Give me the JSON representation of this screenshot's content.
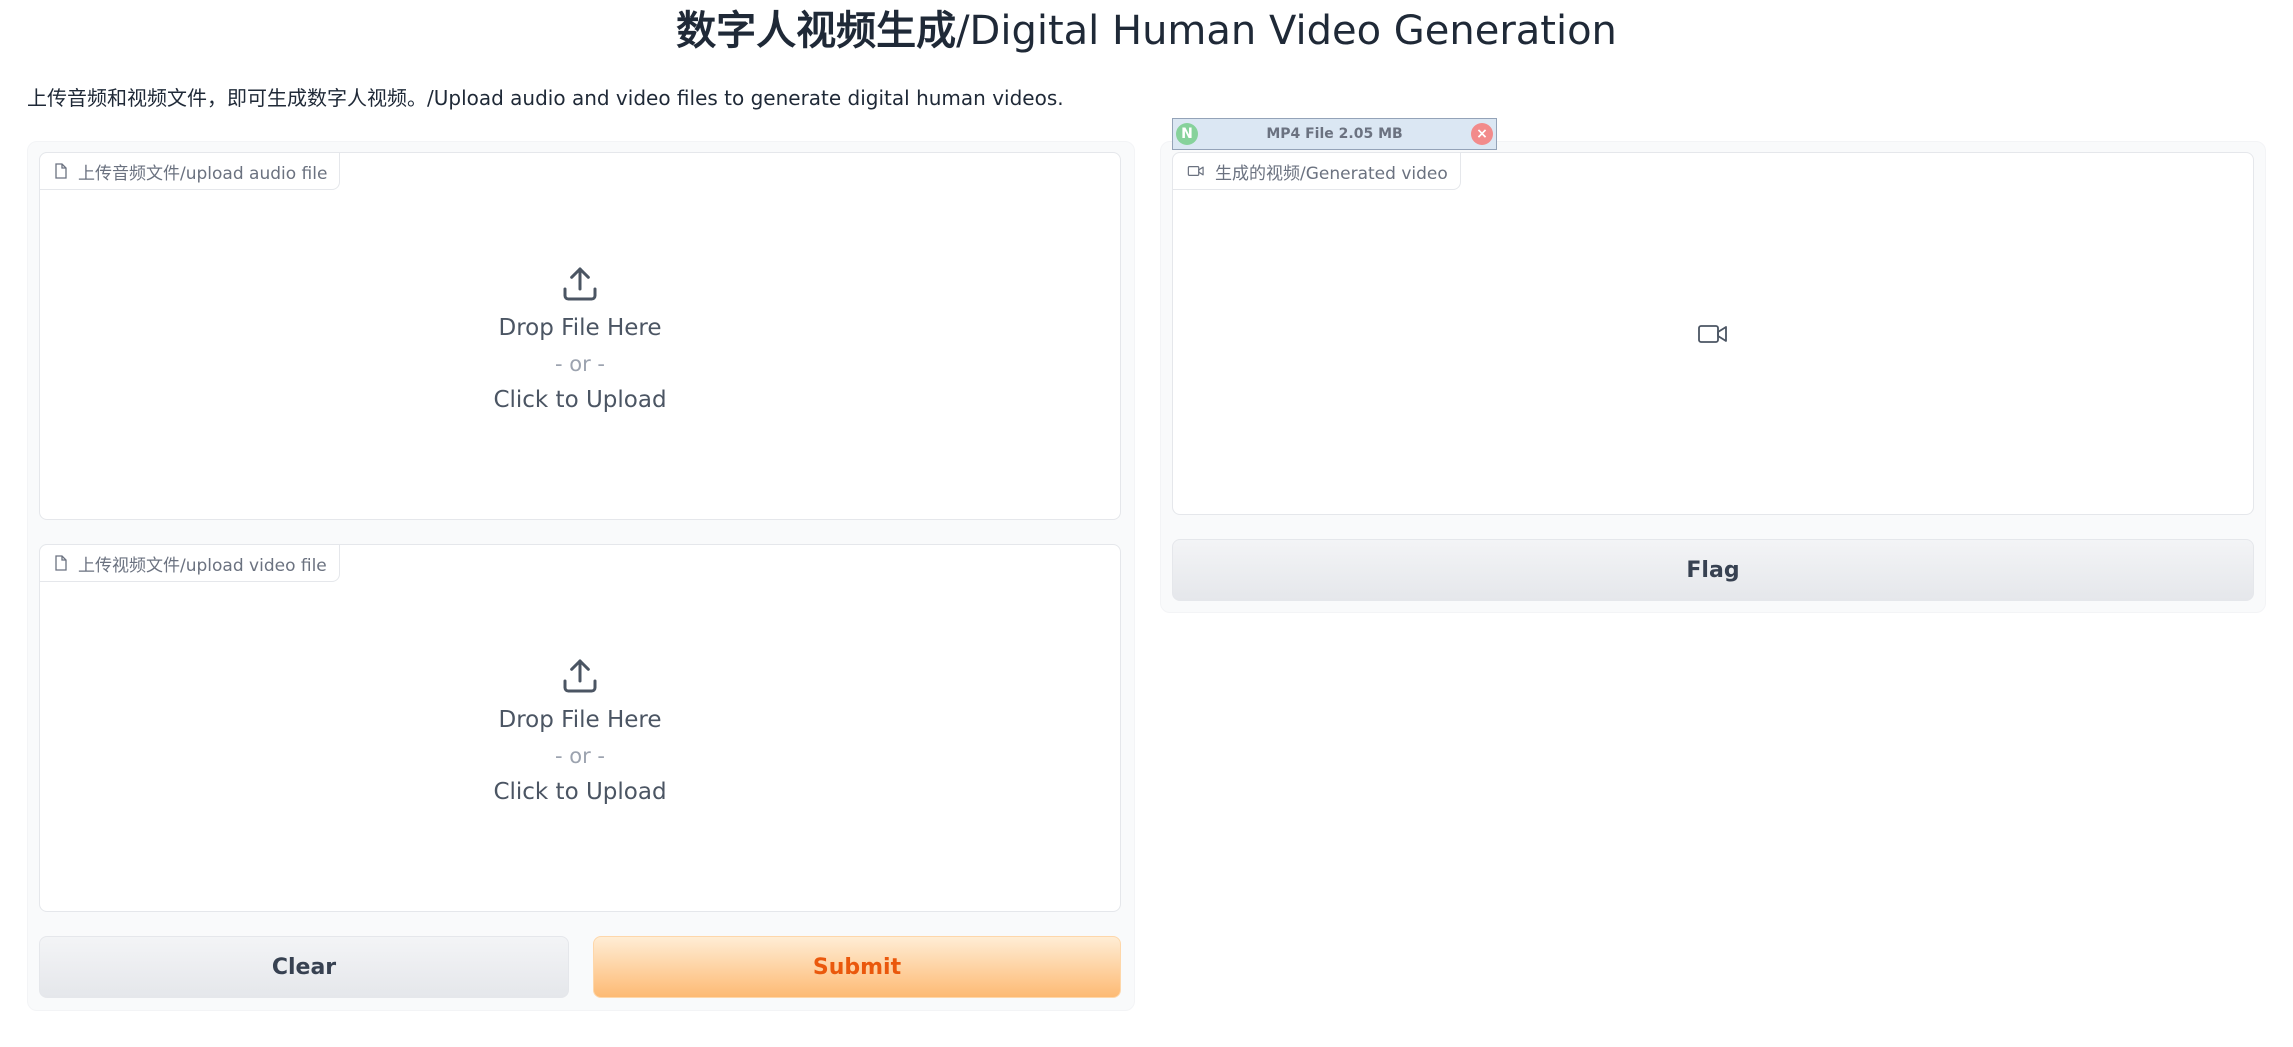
{
  "header": {
    "title_zh": "数字人视频生成",
    "title_en": "/Digital Human Video Generation"
  },
  "description": "上传音频和视频文件，即可生成数字人视频。/Upload audio and video files to generate digital human videos.",
  "inputs": {
    "audio": {
      "label": "上传音频文件/upload audio file",
      "drop_text": "Drop File Here",
      "or_text": "- or -",
      "click_text": "Click to Upload",
      "icon": "file-icon"
    },
    "video": {
      "label": "上传视频文件/upload video file",
      "drop_text": "Drop File Here",
      "or_text": "- or -",
      "click_text": "Click to Upload",
      "icon": "file-icon"
    }
  },
  "output": {
    "label": "生成的视频/Generated video",
    "icon": "video-camera-icon"
  },
  "buttons": {
    "clear": "Clear",
    "submit": "Submit",
    "flag": "Flag"
  },
  "media_bar": {
    "text": "MP4 File 2.05 MB",
    "left_icon": "N",
    "right_icon": "×"
  },
  "colors": {
    "submit_text": "#ea580c",
    "submit_bg_end": "#fdba74"
  }
}
